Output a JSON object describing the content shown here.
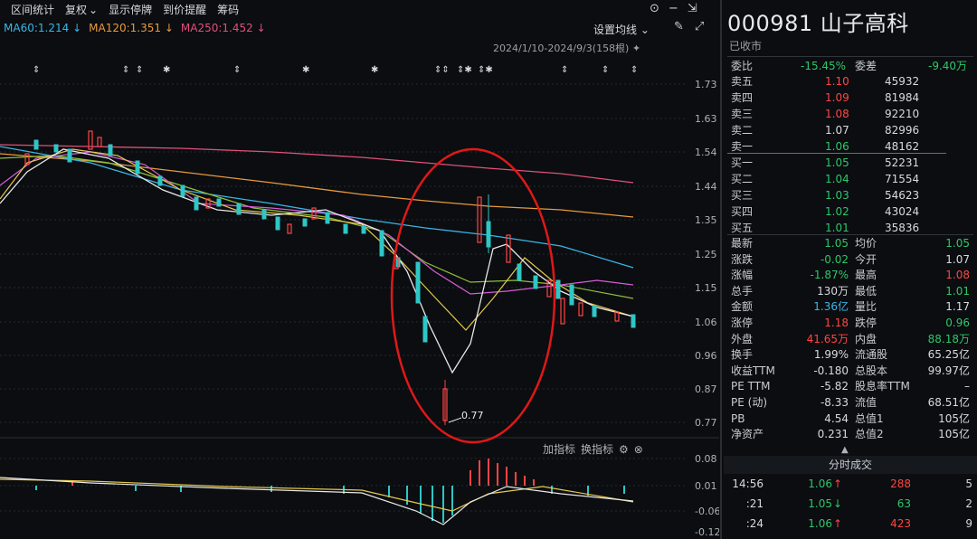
{
  "toolbar": {
    "items": [
      "区间统计",
      "复权",
      "显示停牌",
      "到价提醒",
      "筹码"
    ],
    "active_index": 1,
    "active_arrow": "⌄",
    "icons": [
      "settings-gear-icon",
      "minimize-icon",
      "collapse-icon",
      "pen-icon",
      "fullscreen-icon"
    ]
  },
  "ma": [
    {
      "label": "MA60:1.214",
      "arrow": "↓",
      "color": "#39b6e6"
    },
    {
      "label": "MA120:1.351",
      "arrow": "↓",
      "color": "#e89a3c"
    },
    {
      "label": "MA250:1.452",
      "arrow": "↓",
      "color": "#e0507a"
    }
  ],
  "ma_setting": "设置均线",
  "range": "2024/1/10-2024/9/3(158根)",
  "price_axis": [
    "1.73",
    "1.63",
    "1.54",
    "1.44",
    "1.35",
    "1.25",
    "1.15",
    "1.06",
    "0.96",
    "0.87",
    "0.77"
  ],
  "low_label": "0.77",
  "sub_axis": [
    "0.08",
    "0.01",
    "-0.06",
    "-0.12"
  ],
  "sub_toolbar": {
    "add": "加指标",
    "switch": "换指标"
  },
  "stock": {
    "code_name": "000981 山子高科",
    "status": "已收市"
  },
  "order_book": {
    "weibi_label": "委比",
    "weibi": "-15.45%",
    "weicha_label": "委差",
    "weicha": "-9.40万",
    "asks": [
      {
        "label": "卖五",
        "price": "1.10",
        "vol": "45932",
        "color": "red"
      },
      {
        "label": "卖四",
        "price": "1.09",
        "vol": "81984",
        "color": "red"
      },
      {
        "label": "卖三",
        "price": "1.08",
        "vol": "92210",
        "color": "red"
      },
      {
        "label": "卖二",
        "price": "1.07",
        "vol": "82996",
        "color": "white"
      },
      {
        "label": "卖一",
        "price": "1.06",
        "vol": "48162",
        "color": "green"
      }
    ],
    "bids": [
      {
        "label": "买一",
        "price": "1.05",
        "vol": "52231",
        "color": "green"
      },
      {
        "label": "买二",
        "price": "1.04",
        "vol": "71554",
        "color": "green"
      },
      {
        "label": "买三",
        "price": "1.03",
        "vol": "54623",
        "color": "green"
      },
      {
        "label": "买四",
        "price": "1.02",
        "vol": "43024",
        "color": "green"
      },
      {
        "label": "买五",
        "price": "1.01",
        "vol": "35836",
        "color": "green"
      }
    ]
  },
  "stats": [
    {
      "l1": "最新",
      "v1": "1.05",
      "c1": "green",
      "l2": "均价",
      "v2": "1.05",
      "c2": "green"
    },
    {
      "l1": "涨跌",
      "v1": "-0.02",
      "c1": "green",
      "l2": "今开",
      "v2": "1.07",
      "c2": "white"
    },
    {
      "l1": "涨幅",
      "v1": "-1.87%",
      "c1": "green",
      "l2": "最高",
      "v2": "1.08",
      "c2": "red"
    },
    {
      "l1": "总手",
      "v1": "130万",
      "c1": "white",
      "l2": "最低",
      "v2": "1.01",
      "c2": "green"
    },
    {
      "l1": "金额",
      "v1": "1.36亿",
      "c1": "cyan",
      "l2": "量比",
      "v2": "1.17",
      "c2": "white"
    },
    {
      "l1": "涨停",
      "v1": "1.18",
      "c1": "red",
      "l2": "跌停",
      "v2": "0.96",
      "c2": "green"
    },
    {
      "l1": "外盘",
      "v1": "41.65万",
      "c1": "red",
      "l2": "内盘",
      "v2": "88.18万",
      "c2": "green"
    },
    {
      "l1": "换手",
      "v1": "1.99%",
      "c1": "white",
      "l2": "流通股",
      "v2": "65.25亿",
      "c2": "white"
    },
    {
      "l1": "收益TTM",
      "v1": "-0.180",
      "c1": "white",
      "l2": "总股本",
      "v2": "99.97亿",
      "c2": "white"
    },
    {
      "l1": "PE TTM",
      "v1": "-5.82",
      "c1": "white",
      "l2": "股息率TTM",
      "v2": "–",
      "c2": "white"
    },
    {
      "l1": "PE (动)",
      "v1": "-8.33",
      "c1": "white",
      "l2": "流值",
      "v2": "68.51亿",
      "c2": "white"
    },
    {
      "l1": "PB",
      "v1": "4.54",
      "c1": "white",
      "l2": "总值1",
      "v2": "105亿",
      "c2": "white"
    },
    {
      "l1": "净资产",
      "v1": "0.231",
      "c1": "white",
      "l2": "总值2",
      "v2": "105亿",
      "c2": "white"
    }
  ],
  "ticks_header": "分时成交",
  "ticks": [
    {
      "time": "14:56",
      "price": "1.06",
      "arrow": "↑",
      "pcolor": "red",
      "vol": "288",
      "num": "5"
    },
    {
      "time": ":21",
      "price": "1.05",
      "arrow": "↓",
      "pcolor": "green",
      "vol": "63",
      "num": "2"
    },
    {
      "time": ":24",
      "price": "1.06",
      "arrow": "↑",
      "pcolor": "red",
      "vol": "423",
      "num": "9"
    }
  ],
  "colors": {
    "up": "#ff4545",
    "down": "#2ec6c6",
    "ma_white": "#e8e8e8",
    "ma_yellow": "#e6c84a",
    "ma_pink": "#d65cd6",
    "ma_green": "#8fbf3a",
    "ellipse": "#e01818"
  }
}
